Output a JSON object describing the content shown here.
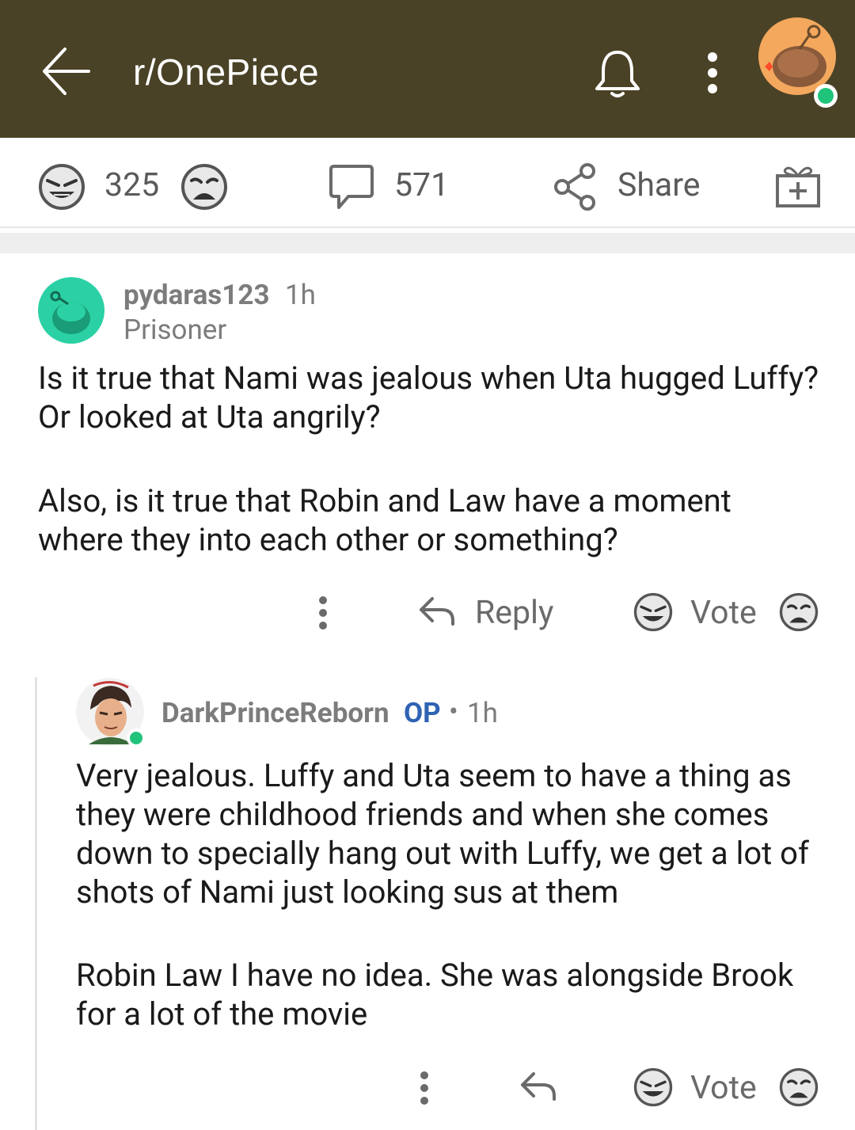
{
  "header": {
    "subreddit": "r/OnePiece",
    "icons": [
      "back-arrow-icon",
      "bell-icon",
      "more-vertical-icon",
      "user-avatar"
    ],
    "background": "#4a4226"
  },
  "post_actions": {
    "score": "325",
    "comments": "571",
    "share_label": "Share"
  },
  "comments": [
    {
      "username": "pydaras123",
      "time": "1h",
      "flair": "Prisoner",
      "paragraphs": [
        "Is it true that Nami was jealous when Uta hugged Luffy? Or looked at Uta angrily?",
        "Also, is it true that Robin and Law have a moment where they into each other or something?"
      ],
      "reply_label": "Reply",
      "vote_label": "Vote"
    },
    {
      "username": "DarkPrinceReborn",
      "op_badge": "OP",
      "separator": "•",
      "time": "1h",
      "paragraphs": [
        "Very jealous. Luffy and Uta seem to have a thing as they were childhood friends and when she comes down to specially hang out with Luffy, we get a lot of shots of Nami just looking sus at them",
        "Robin Law I have no idea. She was alongside Brook for a lot of the movie"
      ],
      "vote_label": "Vote"
    }
  ],
  "colors": {
    "accent_op": "#2f63b3",
    "online": "#1fc47a",
    "avatar_teal": "#2bd1a4"
  }
}
